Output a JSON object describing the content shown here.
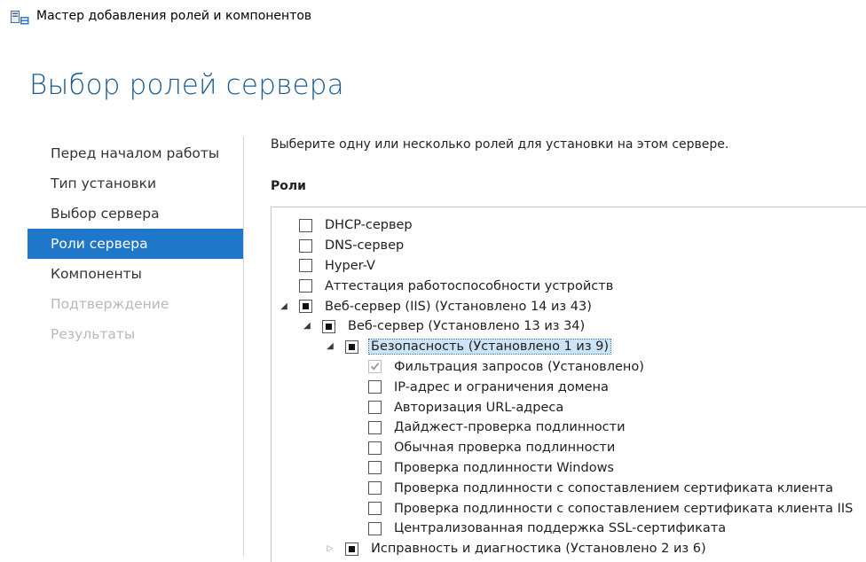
{
  "window": {
    "title": "Мастер добавления ролей и компонентов",
    "icon": "server-manager-icon"
  },
  "page_title": "Выбор ролей сервера",
  "nav": [
    {
      "label": "Перед началом работы",
      "state": "normal"
    },
    {
      "label": "Тип установки",
      "state": "normal"
    },
    {
      "label": "Выбор сервера",
      "state": "normal"
    },
    {
      "label": "Роли сервера",
      "state": "active"
    },
    {
      "label": "Компоненты",
      "state": "normal"
    },
    {
      "label": "Подтверждение",
      "state": "disabled"
    },
    {
      "label": "Результаты",
      "state": "disabled"
    }
  ],
  "instruction": "Выберите одну или несколько ролей для установки на этом сервере.",
  "roles_label": "Роли",
  "roles": [
    {
      "label": "DHCP-сервер",
      "level": 0,
      "expander": "none",
      "check": "unchecked"
    },
    {
      "label": "DNS-сервер",
      "level": 0,
      "expander": "none",
      "check": "unchecked"
    },
    {
      "label": "Hyper-V",
      "level": 0,
      "expander": "none",
      "check": "unchecked"
    },
    {
      "label": "Аттестация работоспособности устройств",
      "level": 0,
      "expander": "none",
      "check": "unchecked"
    },
    {
      "label": "Веб-сервер (IIS) (Установлено 14 из 43)",
      "level": 0,
      "expander": "expanded",
      "check": "indeterminate"
    },
    {
      "label": "Веб-сервер (Установлено 13 из 34)",
      "level": 1,
      "expander": "expanded",
      "check": "indeterminate"
    },
    {
      "label": "Безопасность (Установлено 1 из 9)",
      "level": 2,
      "expander": "expanded",
      "check": "indeterminate",
      "selected": true
    },
    {
      "label": "Фильтрация запросов (Установлено)",
      "level": 3,
      "expander": "none",
      "check": "checked-disabled"
    },
    {
      "label": "IP-адрес и ограничения домена",
      "level": 3,
      "expander": "none",
      "check": "unchecked"
    },
    {
      "label": "Авторизация URL-адреса",
      "level": 3,
      "expander": "none",
      "check": "unchecked"
    },
    {
      "label": "Дайджест-проверка подлинности",
      "level": 3,
      "expander": "none",
      "check": "unchecked"
    },
    {
      "label": "Обычная проверка подлинности",
      "level": 3,
      "expander": "none",
      "check": "unchecked"
    },
    {
      "label": "Проверка подлинности Windows",
      "level": 3,
      "expander": "none",
      "check": "unchecked"
    },
    {
      "label": "Проверка подлинности с сопоставлением сертификата клиента",
      "level": 3,
      "expander": "none",
      "check": "unchecked"
    },
    {
      "label": "Проверка подлинности с сопоставлением сертификата клиента IIS",
      "level": 3,
      "expander": "none",
      "check": "unchecked"
    },
    {
      "label": "Централизованная поддержка SSL-сертификата",
      "level": 3,
      "expander": "none",
      "check": "unchecked"
    },
    {
      "label": "Исправность и диагностика (Установлено 2 из 6)",
      "level": 2,
      "expander": "collapsed",
      "check": "indeterminate"
    }
  ]
}
